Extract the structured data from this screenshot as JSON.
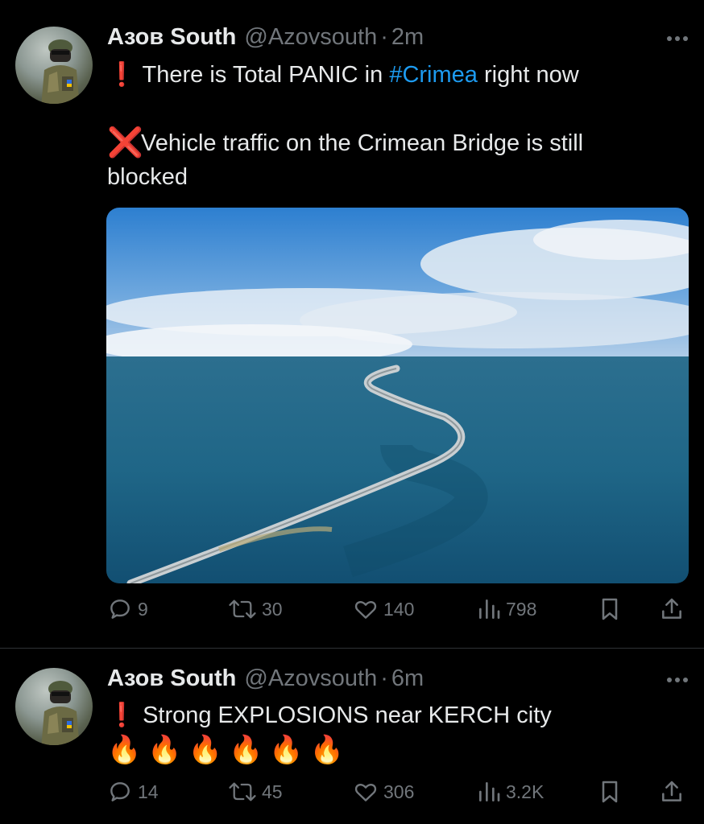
{
  "tweets": [
    {
      "author": {
        "name": "Азов South",
        "handle": "@Azovsouth",
        "separator": "·",
        "time": "2m"
      },
      "text_line1_emoji": "❗",
      "text_line1_prefix": "There is Total PANIC in",
      "hashtag": "#Crimea",
      "text_line1_suffix": "right now",
      "text_line2_emoji": "❌",
      "text_line2": "Vehicle traffic on the Crimean Bridge is still",
      "text_line3": "blocked",
      "media_alt": "Aerial view of the Crimean Bridge over the sea",
      "stats": {
        "replies": "9",
        "retweets": "30",
        "likes": "140",
        "views": "798"
      }
    },
    {
      "author": {
        "name": "Азов South",
        "handle": "@Azovsouth",
        "separator": "·",
        "time": "6m"
      },
      "text_line1_emoji": "❗",
      "text_line1": "Strong EXPLOSIONS near KERCH city",
      "fire_emojis": "🔥🔥🔥🔥🔥🔥",
      "stats": {
        "replies": "14",
        "retweets": "45",
        "likes": "306",
        "views": "3.2K"
      }
    }
  ],
  "icons": {
    "reply": "reply-icon",
    "retweet": "retweet-icon",
    "like": "heart-icon",
    "views": "views-icon",
    "bookmark": "bookmark-icon",
    "share": "share-icon",
    "more": "more-icon"
  },
  "colors": {
    "background": "#000000",
    "text": "#e7e9ea",
    "muted": "#71767b",
    "link": "#1d9bf0",
    "divider": "#2f3336"
  }
}
